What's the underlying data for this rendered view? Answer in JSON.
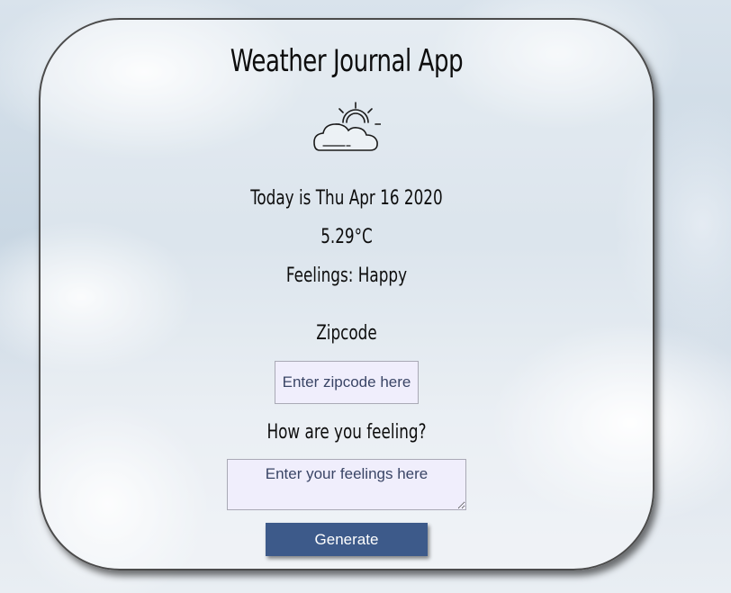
{
  "app": {
    "title": "Weather Journal App"
  },
  "icon": "partly-cloudy-sun-icon",
  "entry": {
    "date": "Today is Thu Apr 16 2020",
    "temperature": "5.29°C",
    "feelings": "Feelings: Happy"
  },
  "form": {
    "zip_label": "Zipcode",
    "zip_placeholder": "Enter zipcode here",
    "zip_value": "",
    "feel_label": "How are you feeling?",
    "feel_placeholder": "Enter your feelings here",
    "feel_value": "",
    "generate_label": "Generate"
  },
  "colors": {
    "button": "#3d5a8a",
    "input_bg": "#f0eefc"
  }
}
